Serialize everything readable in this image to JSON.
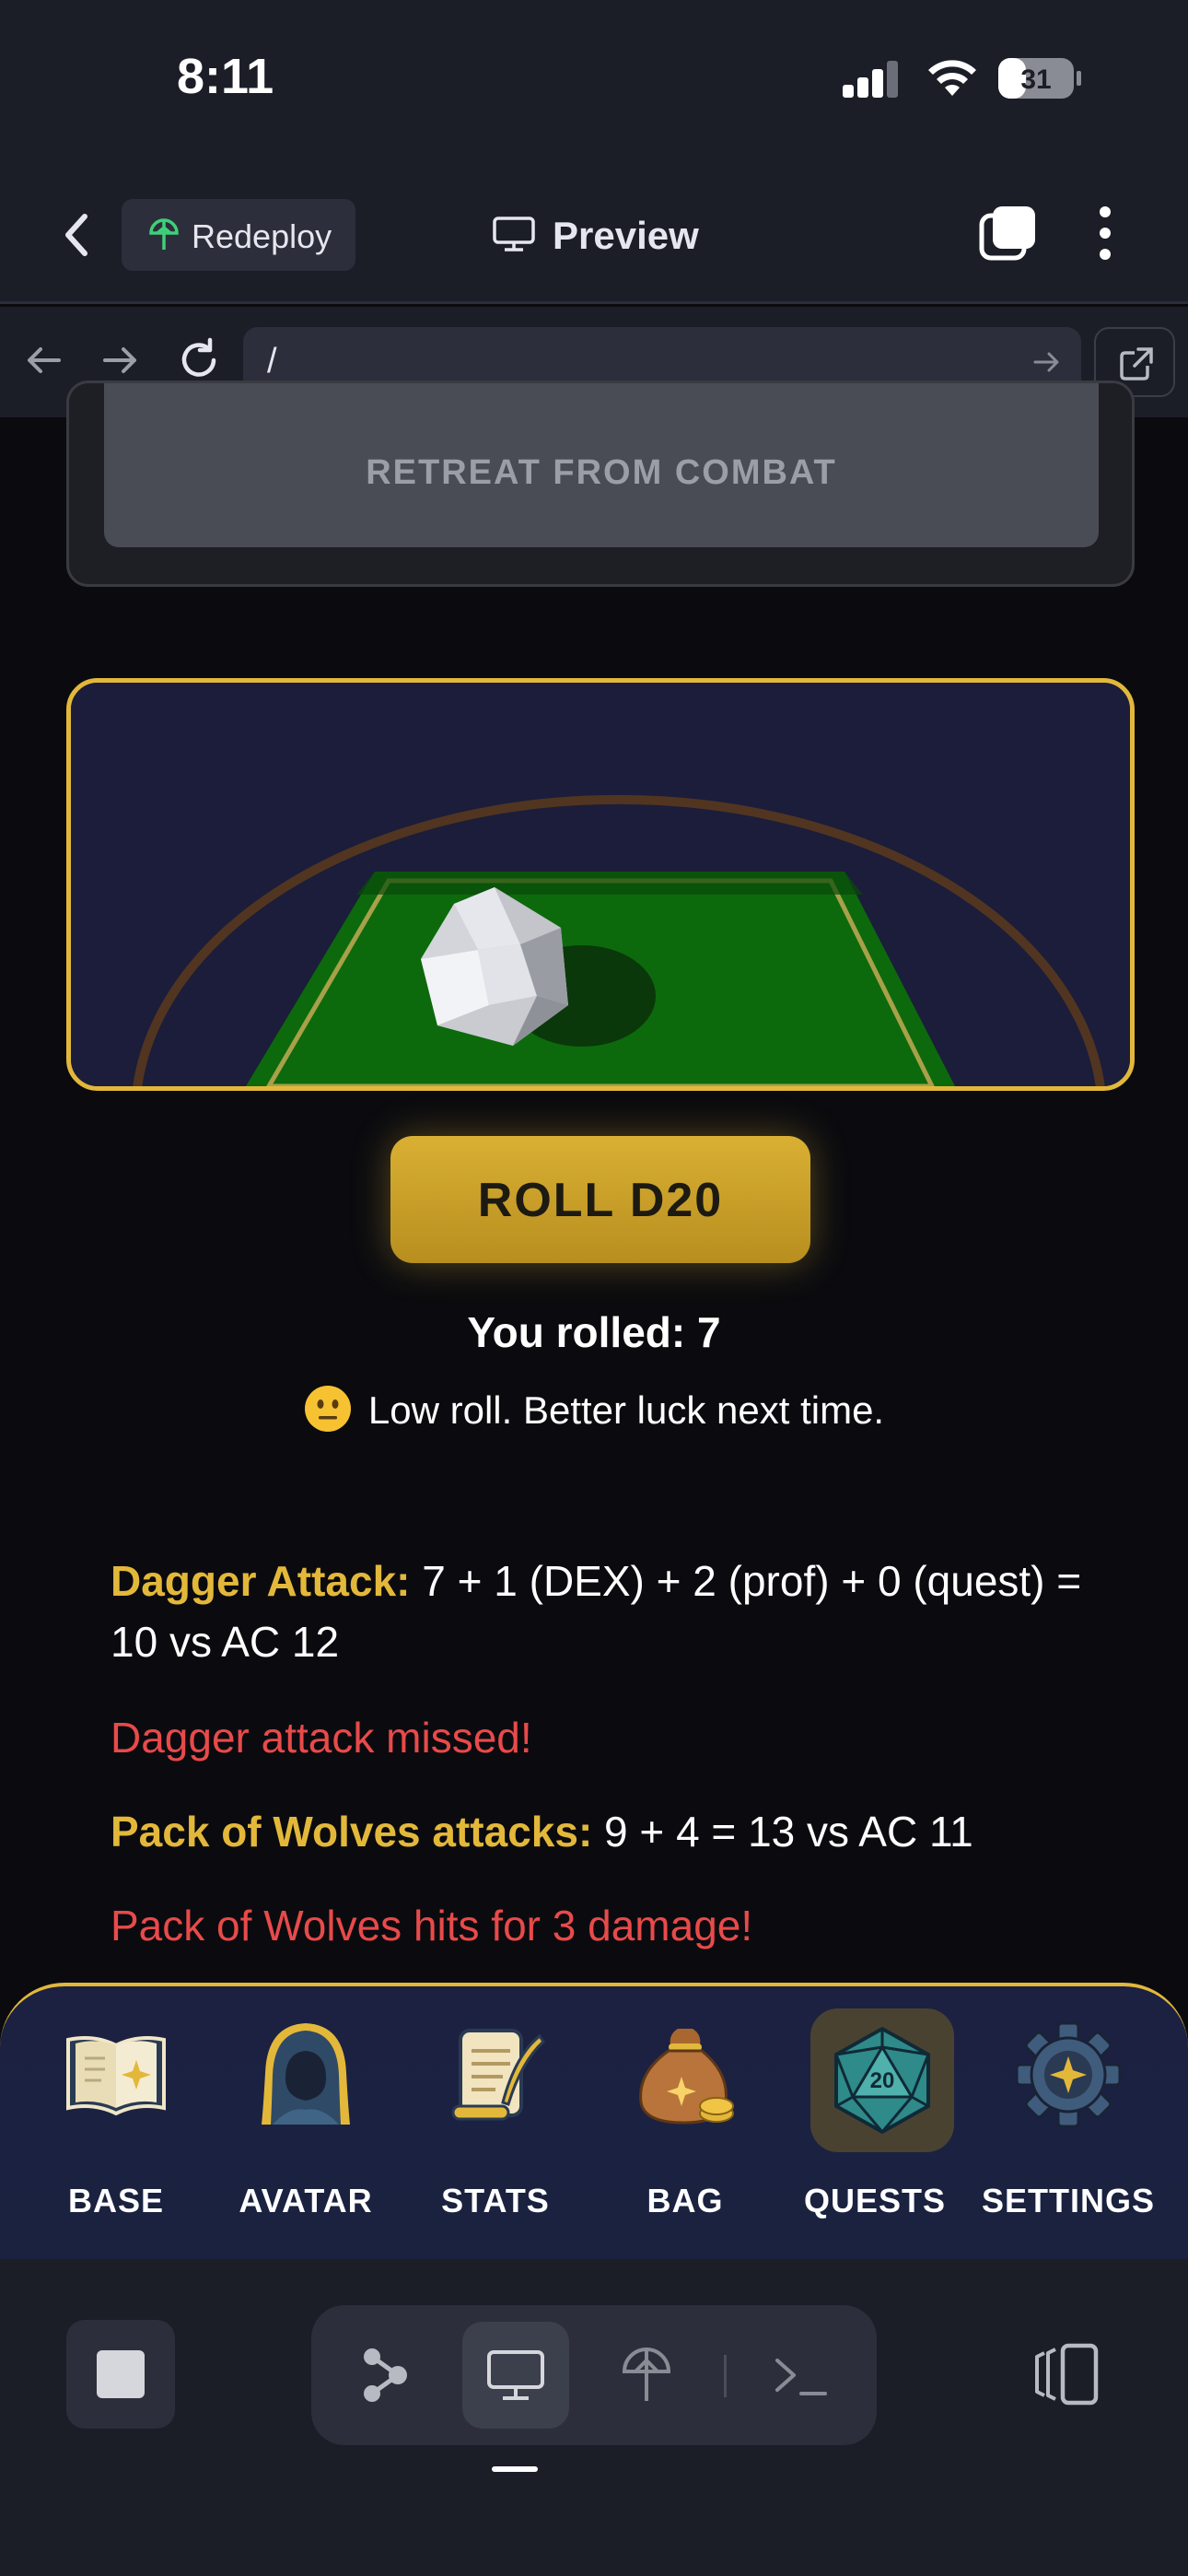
{
  "status_bar": {
    "time": "8:11",
    "battery": "31"
  },
  "header": {
    "redeploy_label": "Redeploy",
    "preview_label": "Preview"
  },
  "url_bar": {
    "url": "/"
  },
  "combat": {
    "retreat_label": "RETREAT FROM COMBAT"
  },
  "dice": {
    "roll_button": "ROLL D20",
    "result_text": "You rolled: 7",
    "result_message": "Low roll. Better luck next time."
  },
  "log": [
    {
      "label": "Dagger Attack:",
      "text": " 7 + 1 (DEX) + 2 (prof) + 0 (quest) = 10 vs AC 12"
    },
    {
      "text": "Dagger attack missed!"
    },
    {
      "label": "Pack of Wolves attacks:",
      "text": " 9 + 4 = 13 vs AC 11"
    },
    {
      "text": "Pack of Wolves hits for 3 damage!"
    }
  ],
  "bottom_nav": [
    {
      "label": "BASE",
      "icon": "open-book-icon"
    },
    {
      "label": "AVATAR",
      "icon": "hooded-figure-icon"
    },
    {
      "label": "STATS",
      "icon": "scroll-quill-icon"
    },
    {
      "label": "BAG",
      "icon": "coin-bag-icon"
    },
    {
      "label": "QUESTS",
      "icon": "d20-icon",
      "active": true,
      "die_face": "20"
    },
    {
      "label": "SETTINGS",
      "icon": "gear-icon"
    }
  ],
  "colors": {
    "accent_gold": "#e3b83a",
    "miss_red": "#e84a4a",
    "panel_navy": "#1b1d3a",
    "table_green": "#0c6a0c"
  }
}
